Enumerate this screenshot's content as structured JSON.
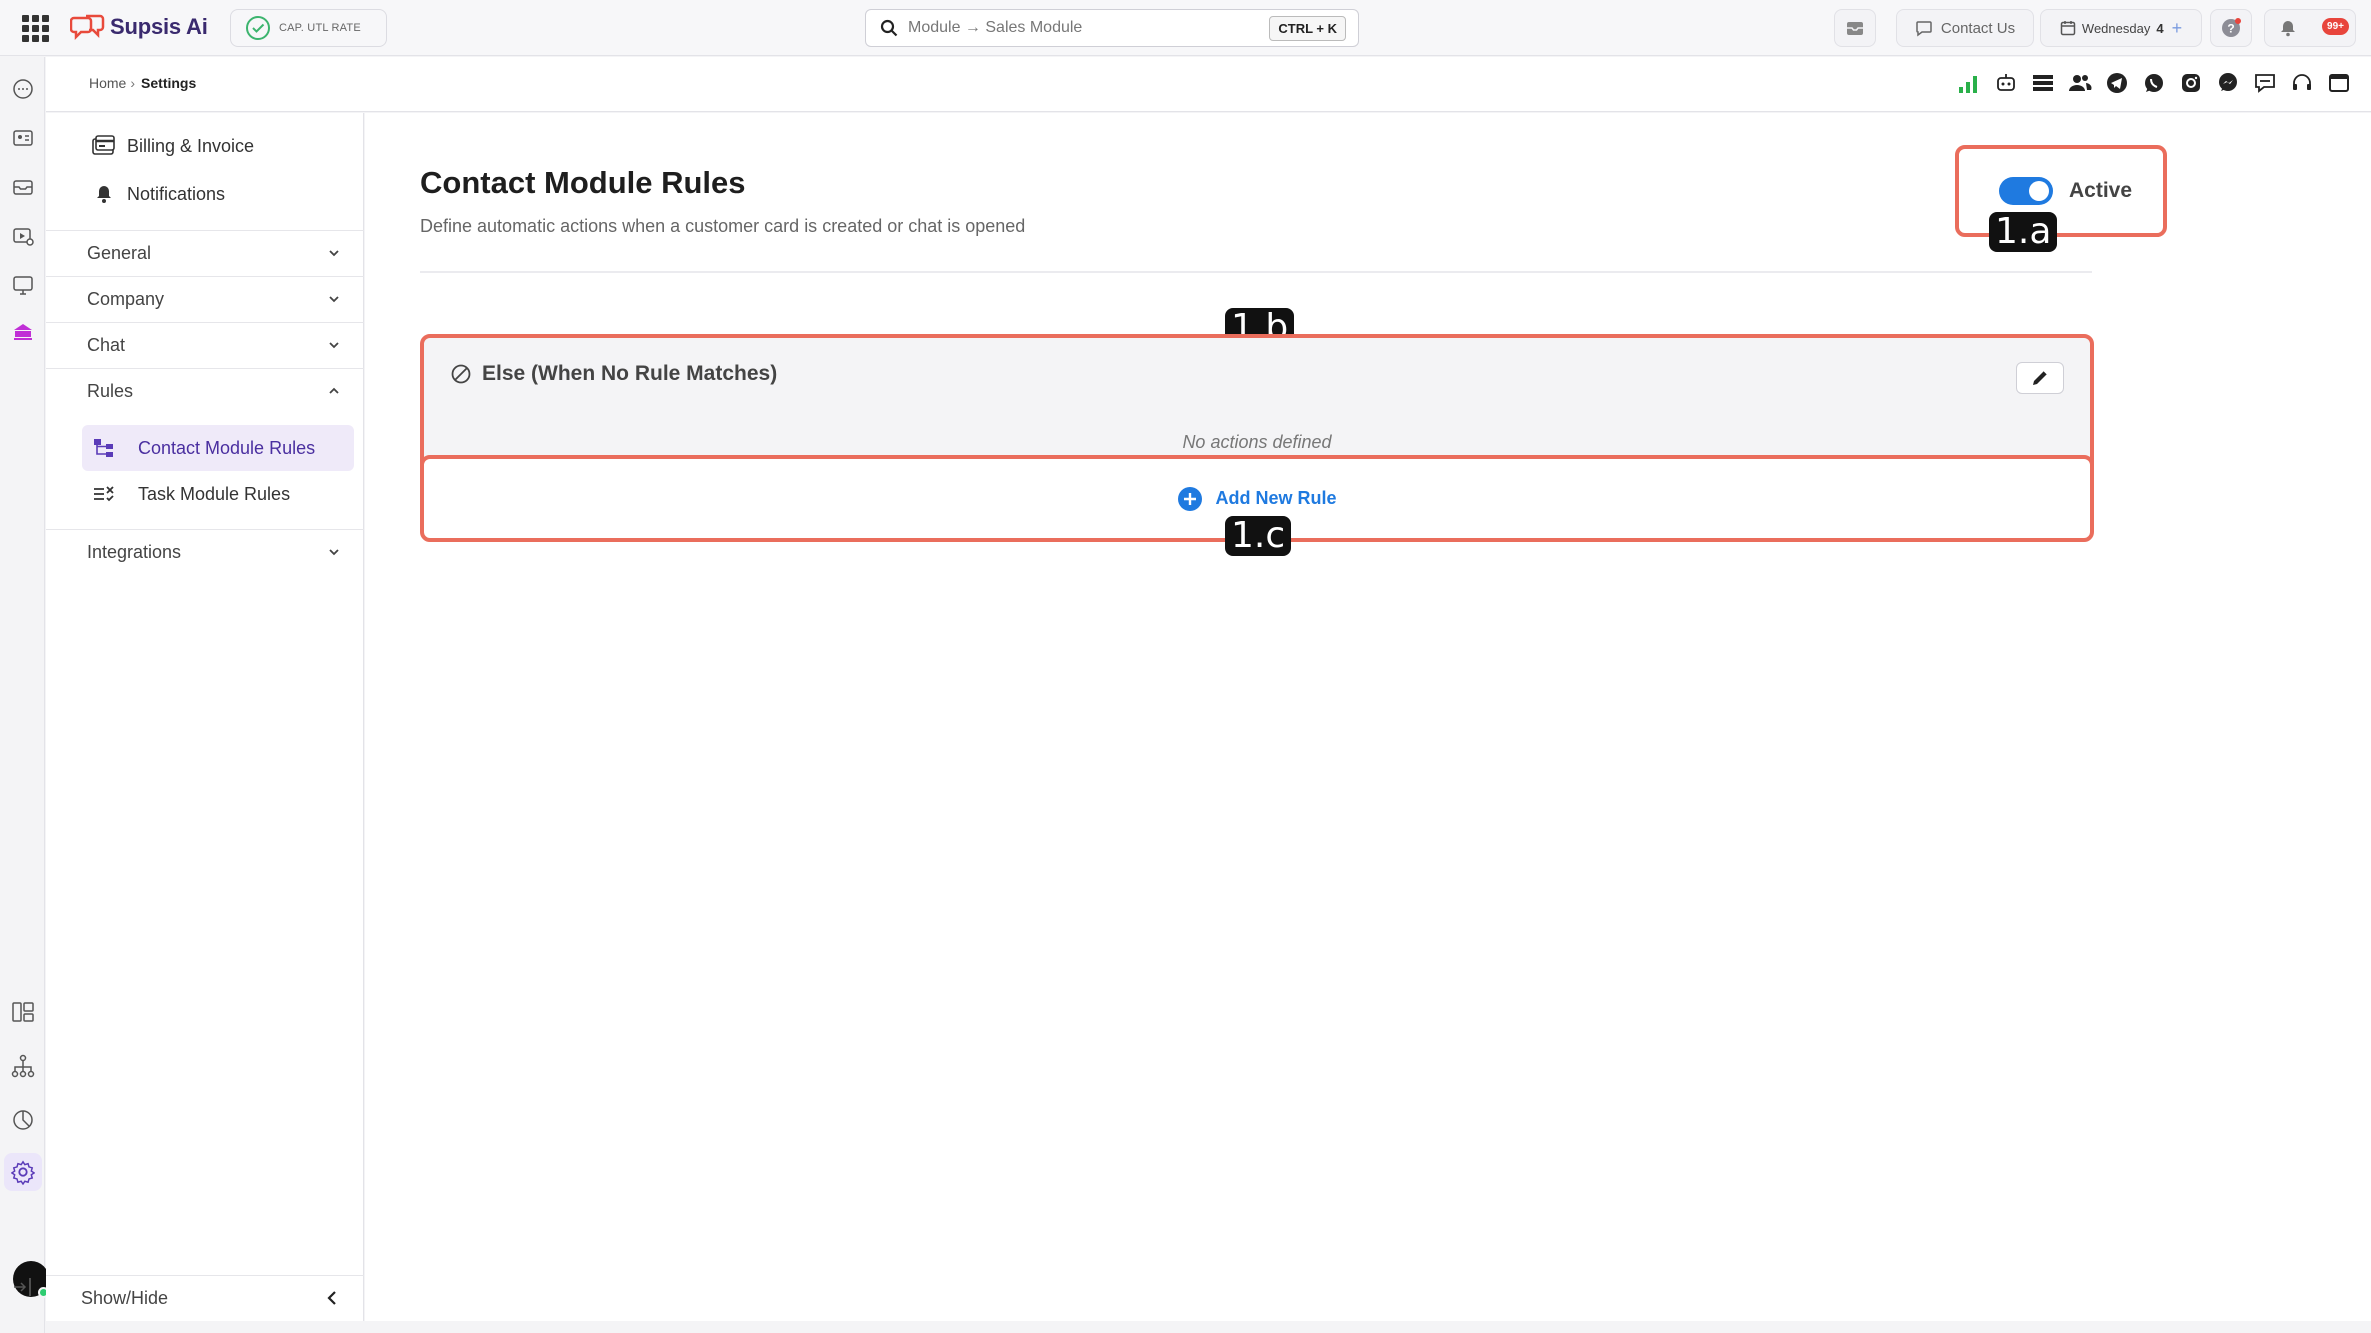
{
  "app": {
    "name": "Supsis Ai",
    "cap_label": "CAP. UTL RATE",
    "search_placeholder": "Module → Sales Module",
    "search_shortcut": "CTRL + K",
    "contact_us": "Contact Us",
    "date_day": "Wednesday",
    "date_num": "4",
    "notif_badge": "99+"
  },
  "breadcrumb": {
    "home": "Home",
    "separator": "›",
    "current": "Settings"
  },
  "sidebar": {
    "links": [
      {
        "label": "Billing & Invoice",
        "icon": "billing-icon"
      },
      {
        "label": "Notifications",
        "icon": "bell-icon"
      }
    ],
    "sections": [
      {
        "label": "General",
        "expanded": false
      },
      {
        "label": "Company",
        "expanded": false
      },
      {
        "label": "Chat",
        "expanded": false
      },
      {
        "label": "Rules",
        "expanded": true
      },
      {
        "label": "Integrations",
        "expanded": false
      }
    ],
    "rules_items": [
      {
        "label": "Contact Module Rules",
        "active": true
      },
      {
        "label": "Task Module Rules",
        "active": false
      }
    ],
    "footer": "Show/Hide"
  },
  "main": {
    "title": "Contact Module Rules",
    "subtitle": "Define automatic actions when a customer card is created or chat is opened",
    "toggle_label": "Active",
    "toggle_on": true,
    "else_rule_title": "Else (When No Rule Matches)",
    "no_actions": "No actions defined",
    "add_rule": "Add New Rule"
  },
  "annotations": {
    "a": "1.a",
    "b": "1.b",
    "c": "1.c"
  },
  "colors": {
    "accent": "#1f7ae0",
    "brand": "#3a2a6e",
    "annotation_border": "#ea6d5c",
    "active_nav": "#efeaf9"
  }
}
